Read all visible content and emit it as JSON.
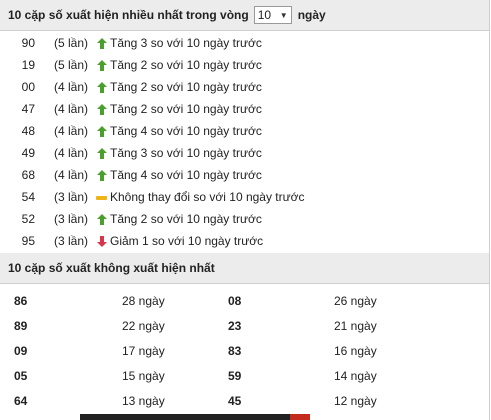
{
  "top_section": {
    "title_before": "10 cặp số xuất hiện nhiều nhất trong vòng",
    "select_value": "10",
    "title_after": "ngày",
    "rows": [
      {
        "number": "90",
        "count": "(5 lần)",
        "trend": "up",
        "text": "Tăng 3 so với 10 ngày trước"
      },
      {
        "number": "19",
        "count": "(5 lần)",
        "trend": "up",
        "text": "Tăng 2 so với 10 ngày trước"
      },
      {
        "number": "00",
        "count": "(4 lần)",
        "trend": "up",
        "text": "Tăng 2 so với 10 ngày trước"
      },
      {
        "number": "47",
        "count": "(4 lần)",
        "trend": "up",
        "text": "Tăng 2 so với 10 ngày trước"
      },
      {
        "number": "48",
        "count": "(4 lần)",
        "trend": "up",
        "text": "Tăng 4 so với 10 ngày trước"
      },
      {
        "number": "49",
        "count": "(4 lần)",
        "trend": "up",
        "text": "Tăng 3 so với 10 ngày trước"
      },
      {
        "number": "68",
        "count": "(4 lần)",
        "trend": "up",
        "text": "Tăng 4 so với 10 ngày trước"
      },
      {
        "number": "54",
        "count": "(3 lần)",
        "trend": "flat",
        "text": "Không thay đổi so với 10 ngày trước"
      },
      {
        "number": "52",
        "count": "(3 lần)",
        "trend": "up",
        "text": "Tăng 2 so với 10 ngày trước"
      },
      {
        "number": "95",
        "count": "(3 lần)",
        "trend": "down",
        "text": "Giảm 1 so với 10 ngày trước"
      }
    ]
  },
  "bottom_section": {
    "title": "10 cặp số xuất không xuất hiện nhất",
    "rows": [
      {
        "n1": "86",
        "d1": "28 ngày",
        "n2": "08",
        "d2": "26 ngày"
      },
      {
        "n1": "89",
        "d1": "22 ngày",
        "n2": "23",
        "d2": "21 ngày"
      },
      {
        "n1": "09",
        "d1": "17 ngày",
        "n2": "83",
        "d2": "16 ngày"
      },
      {
        "n1": "05",
        "d1": "15 ngày",
        "n2": "59",
        "d2": "14 ngày"
      },
      {
        "n1": "64",
        "d1": "13 ngày",
        "n2": "45",
        "d2": "12 ngày"
      }
    ]
  },
  "colors": {
    "up": "#4aa02c",
    "down": "#d9354b",
    "flat": "#f0b417",
    "header_bg": "#ececec"
  },
  "icons": {
    "up": "green-up-arrow-icon",
    "down": "red-down-arrow-icon",
    "flat": "yellow-flat-bar-icon",
    "select": "dropdown-caret-icon"
  }
}
